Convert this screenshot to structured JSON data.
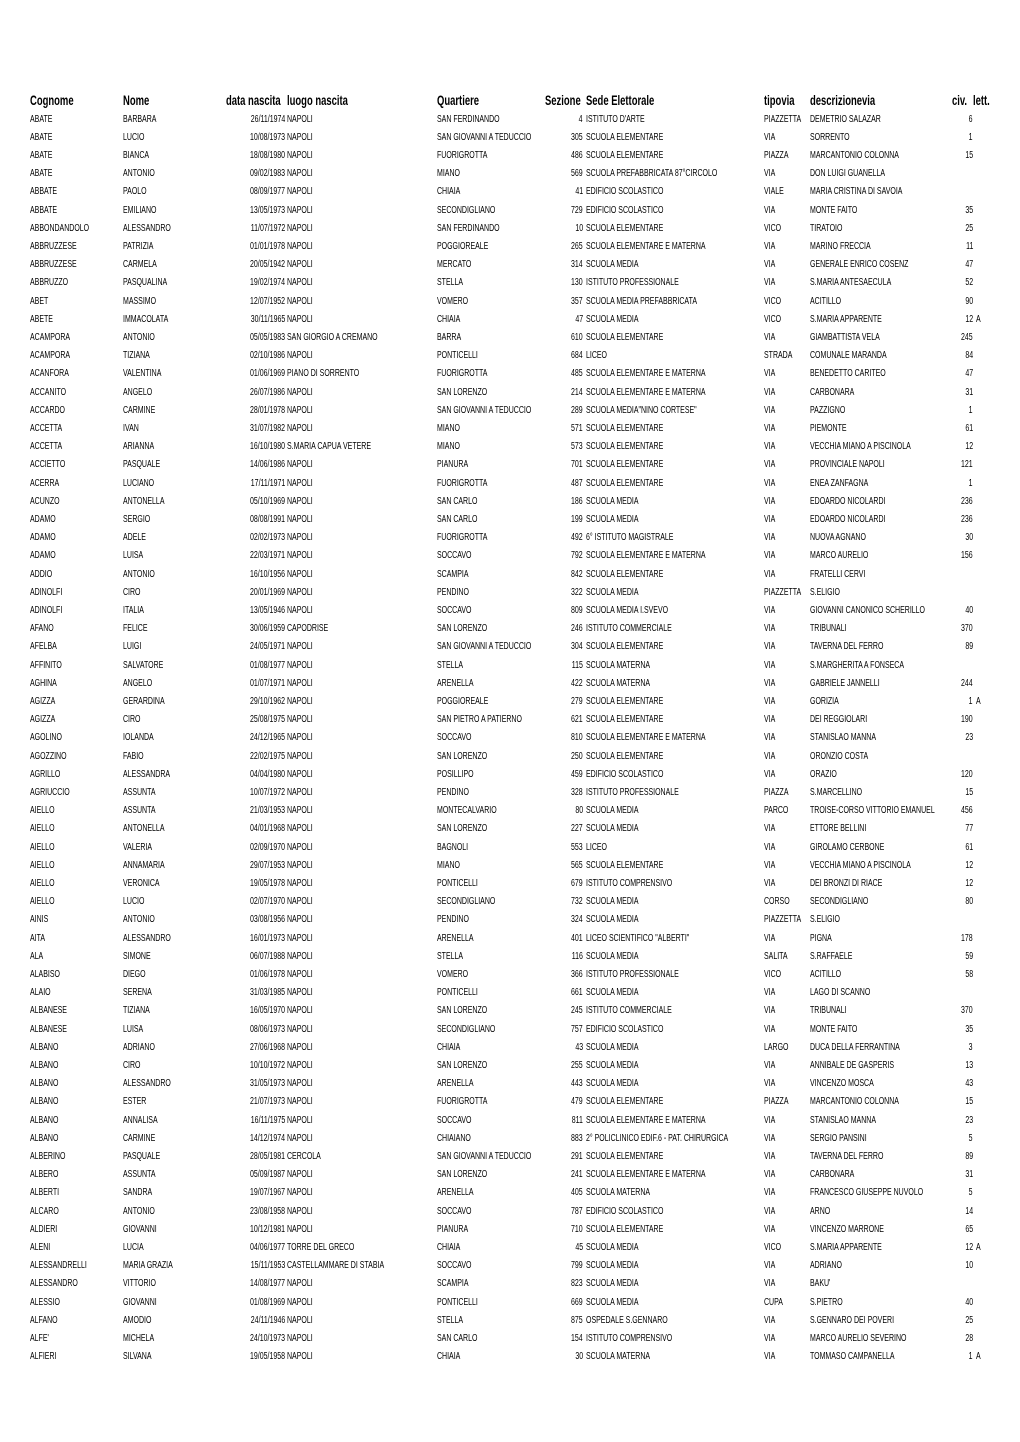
{
  "headers": [
    "Cognome",
    "Nome",
    "data nascita",
    "luogo nascita",
    "Quartiere",
    "Sezione",
    "Sede Elettorale",
    "tipovia",
    "descrizionevia",
    "civ.",
    "lett."
  ],
  "rows": [
    [
      "ABATE",
      "BARBARA",
      "26/11/1974",
      "NAPOLI",
      "SAN FERDINANDO",
      "4",
      "ISTITUTO D'ARTE",
      "PIAZZETTA",
      "DEMETRIO SALAZAR",
      "6",
      ""
    ],
    [
      "ABATE",
      "LUCIO",
      "10/08/1973",
      "NAPOLI",
      "SAN GIOVANNI A TEDUCCIO",
      "305",
      "SCUOLA ELEMENTARE",
      "VIA",
      "SORRENTO",
      "1",
      ""
    ],
    [
      "ABATE",
      "BIANCA",
      "18/08/1980",
      "NAPOLI",
      "FUORIGROTTA",
      "486",
      "SCUOLA ELEMENTARE",
      "PIAZZA",
      "MARCANTONIO COLONNA",
      "15",
      ""
    ],
    [
      "ABATE",
      "ANTONIO",
      "09/02/1983",
      "NAPOLI",
      "MIANO",
      "569",
      "SCUOLA PREFABBRICATA 87°CIRCOLO",
      "VIA",
      "DON LUIGI GUANELLA",
      "",
      ""
    ],
    [
      "ABBATE",
      "PAOLO",
      "08/09/1977",
      "NAPOLI",
      "CHIAIA",
      "41",
      "EDIFICIO SCOLASTICO",
      "VIALE",
      "MARIA CRISTINA DI SAVOIA",
      "",
      ""
    ],
    [
      "ABBATE",
      "EMILIANO",
      "13/05/1973",
      "NAPOLI",
      "SECONDIGLIANO",
      "729",
      "EDIFICIO SCOLASTICO",
      "VIA",
      "MONTE FAITO",
      "35",
      ""
    ],
    [
      "ABBONDANDOLO",
      "ALESSANDRO",
      "11/07/1972",
      "NAPOLI",
      "SAN FERDINANDO",
      "10",
      "SCUOLA ELEMENTARE",
      "VICO",
      "TIRATOIO",
      "25",
      ""
    ],
    [
      "ABBRUZZESE",
      "PATRIZIA",
      "01/01/1978",
      "NAPOLI",
      "POGGIOREALE",
      "265",
      "SCUOLA ELEMENTARE E MATERNA",
      "VIA",
      "MARINO FRECCIA",
      "11",
      ""
    ],
    [
      "ABBRUZZESE",
      "CARMELA",
      "20/05/1942",
      "NAPOLI",
      "MERCATO",
      "314",
      " SCUOLA MEDIA",
      "VIA",
      "GENERALE ENRICO COSENZ",
      "47",
      ""
    ],
    [
      "ABBRUZZO",
      "PASQUALINA",
      "19/02/1974",
      "NAPOLI",
      "STELLA",
      "130",
      "ISTITUTO PROFESSIONALE",
      "VIA",
      "S.MARIA ANTESAECULA",
      "52",
      ""
    ],
    [
      "ABET",
      "MASSIMO",
      "12/07/1952",
      "NAPOLI",
      "VOMERO",
      "357",
      "SCUOLA MEDIA PREFABBRICATA",
      "VICO",
      "ACITILLO",
      "90",
      ""
    ],
    [
      "ABETE",
      "IMMACOLATA",
      "30/11/1965",
      "NAPOLI",
      "CHIAIA",
      "47",
      "SCUOLA MEDIA",
      "VICO",
      "S.MARIA APPARENTE",
      "12",
      "A"
    ],
    [
      "ACAMPORA",
      "ANTONIO",
      "05/05/1983",
      "SAN GIORGIO A CREMANO",
      "BARRA",
      "610",
      "SCUOLA ELEMENTARE",
      "VIA",
      "GIAMBATTISTA VELA",
      "245",
      ""
    ],
    [
      "ACAMPORA",
      "TIZIANA",
      "02/10/1986",
      "NAPOLI",
      "PONTICELLI",
      "684",
      "LICEO",
      "STRADA",
      "COMUNALE MARANDA",
      "84",
      ""
    ],
    [
      "ACANFORA",
      "VALENTINA",
      "01/06/1969",
      "PIANO DI SORRENTO",
      "FUORIGROTTA",
      "485",
      "SCUOLA ELEMENTARE E MATERNA",
      "VIA",
      "BENEDETTO CARITEO",
      "47",
      ""
    ],
    [
      "ACCANITO",
      "ANGELO",
      "26/07/1986",
      "NAPOLI",
      "SAN LORENZO",
      "214",
      "SCUOLA ELEMENTARE E MATERNA",
      "VIA",
      "CARBONARA",
      "31",
      ""
    ],
    [
      "ACCARDO",
      "CARMINE",
      "28/01/1978",
      "NAPOLI",
      "SAN GIOVANNI A TEDUCCIO",
      "289",
      "SCUOLA MEDIA\"NINO CORTESE\"",
      "VIA",
      "PAZZIGNO",
      "1",
      ""
    ],
    [
      "ACCETTA",
      "IVAN",
      "31/07/1982",
      "NAPOLI",
      "MIANO",
      "571",
      "SCUOLA ELEMENTARE",
      "VIA",
      "PIEMONTE",
      "61",
      ""
    ],
    [
      "ACCETTA",
      "ARIANNA",
      "16/10/1980",
      "S.MARIA CAPUA VETERE",
      "MIANO",
      "573",
      "SCUOLA ELEMENTARE",
      "VIA",
      "VECCHIA MIANO A PISCINOLA",
      "12",
      ""
    ],
    [
      "ACCIETTO",
      "PASQUALE",
      "14/06/1986",
      "NAPOLI",
      "PIANURA",
      "701",
      "SCUOLA ELEMENTARE",
      "VIA",
      "PROVINCIALE NAPOLI",
      "121",
      ""
    ],
    [
      "ACERRA",
      "LUCIANO",
      "17/11/1971",
      "NAPOLI",
      "FUORIGROTTA",
      "487",
      "SCUOLA ELEMENTARE",
      "VIA",
      "ENEA ZANFAGNA",
      "1",
      ""
    ],
    [
      "ACUNZO",
      "ANTONELLA",
      "05/10/1969",
      "NAPOLI",
      "SAN CARLO",
      "186",
      "SCUOLA MEDIA",
      "VIA",
      "EDOARDO NICOLARDI",
      "236",
      ""
    ],
    [
      "ADAMO",
      "SERGIO",
      "08/08/1991",
      "NAPOLI",
      "SAN CARLO",
      "199",
      "SCUOLA MEDIA",
      "VIA",
      "EDOARDO NICOLARDI",
      "236",
      ""
    ],
    [
      "ADAMO",
      "ADELE",
      "02/02/1973",
      "NAPOLI",
      "FUORIGROTTA",
      "492",
      "6° ISTITUTO MAGISTRALE",
      "VIA",
      "NUOVA AGNANO",
      "30",
      ""
    ],
    [
      "ADAMO",
      "LUISA",
      "22/03/1971",
      "NAPOLI",
      "SOCCAVO",
      "792",
      "SCUOLA ELEMENTARE E MATERNA",
      "VIA",
      "MARCO AURELIO",
      "156",
      ""
    ],
    [
      "ADDIO",
      "ANTONIO",
      "16/10/1956",
      "NAPOLI",
      "SCAMPIA",
      "842",
      "SCUOLA ELEMENTARE",
      "VIA",
      "FRATELLI CERVI",
      "",
      ""
    ],
    [
      "ADINOLFI",
      "CIRO",
      "20/01/1969",
      "NAPOLI",
      "PENDINO",
      "322",
      "SCUOLA MEDIA",
      "PIAZZETTA",
      "S.ELIGIO",
      "",
      ""
    ],
    [
      "ADINOLFI",
      "ITALIA",
      "13/05/1946",
      "NAPOLI",
      "SOCCAVO",
      "809",
      "SCUOLA MEDIA I.SVEVO",
      "VIA",
      "GIOVANNI CANONICO SCHERILLO",
      "40",
      ""
    ],
    [
      "AFANO",
      "FELICE",
      "30/06/1959",
      "CAPODRISE",
      "SAN LORENZO",
      "246",
      "ISTITUTO COMMERCIALE",
      "VIA",
      "TRIBUNALI",
      "370",
      ""
    ],
    [
      "AFELBA",
      "LUIGI",
      "24/05/1971",
      "NAPOLI",
      "SAN GIOVANNI A TEDUCCIO",
      "304",
      "SCUOLA ELEMENTARE",
      "VIA",
      "TAVERNA DEL FERRO",
      "89",
      ""
    ],
    [
      "AFFINITO",
      "SALVATORE",
      "01/08/1977",
      "NAPOLI",
      "STELLA",
      "115",
      "SCUOLA MATERNA",
      "VIA",
      "S.MARGHERITA A FONSECA",
      "",
      ""
    ],
    [
      "AGHINA",
      "ANGELO",
      "01/07/1971",
      "NAPOLI",
      "ARENELLA",
      "422",
      "SCUOLA MATERNA",
      "VIA",
      "GABRIELE JANNELLI",
      "244",
      ""
    ],
    [
      "AGIZZA",
      "GERARDINA",
      "29/10/1962",
      "NAPOLI",
      "POGGIOREALE",
      "279",
      "SCUOLA ELEMENTARE",
      "VIA",
      "GORIZIA",
      "1",
      "A"
    ],
    [
      "AGIZZA",
      "CIRO",
      "25/08/1975",
      "NAPOLI",
      "SAN PIETRO A PATIERNO",
      "621",
      "SCUOLA ELEMENTARE",
      "VIA",
      "DEI REGGIOLARI",
      "190",
      ""
    ],
    [
      "AGOLINO",
      "IOLANDA",
      "24/12/1965",
      "NAPOLI",
      "SOCCAVO",
      "810",
      "SCUOLA ELEMENTARE E MATERNA",
      "VIA",
      "STANISLAO MANNA",
      "23",
      ""
    ],
    [
      "AGOZZINO",
      "FABIO",
      "22/02/1975",
      "NAPOLI",
      "SAN LORENZO",
      "250",
      "SCUOLA ELEMENTARE",
      "VIA",
      "ORONZIO COSTA",
      "",
      ""
    ],
    [
      "AGRILLO",
      "ALESSANDRA",
      "04/04/1980",
      "NAPOLI",
      "POSILLIPO",
      "459",
      "EDIFICIO SCOLASTICO",
      "VIA",
      "ORAZIO",
      "120",
      ""
    ],
    [
      "AGRIUCCIO",
      "ASSUNTA",
      "10/07/1972",
      "NAPOLI",
      "PENDINO",
      "328",
      "ISTITUTO PROFESSIONALE",
      "PIAZZA",
      "S.MARCELLINO",
      "15",
      ""
    ],
    [
      "AIELLO",
      "ASSUNTA",
      "21/03/1953",
      "NAPOLI",
      "MONTECALVARIO",
      "80",
      "SCUOLA MEDIA",
      "PARCO",
      "TROISE-CORSO VITTORIO EMANUEL",
      "456",
      ""
    ],
    [
      "AIELLO",
      "ANTONELLA",
      "04/01/1968",
      "NAPOLI",
      "SAN LORENZO",
      "227",
      "SCUOLA MEDIA",
      "VIA",
      "ETTORE BELLINI",
      "77",
      ""
    ],
    [
      "AIELLO",
      "VALERIA",
      "02/09/1970",
      "NAPOLI",
      "BAGNOLI",
      "553",
      "LICEO",
      "VIA",
      "GIROLAMO CERBONE",
      "61",
      ""
    ],
    [
      "AIELLO",
      "ANNAMARIA",
      "29/07/1953",
      "NAPOLI",
      "MIANO",
      "565",
      "SCUOLA ELEMENTARE",
      "VIA",
      "VECCHIA MIANO A PISCINOLA",
      "12",
      ""
    ],
    [
      "AIELLO",
      "VERONICA",
      "19/05/1978",
      "NAPOLI",
      "PONTICELLI",
      "679",
      "ISTITUTO COMPRENSIVO",
      "VIA",
      "DEI BRONZI DI RIACE",
      "12",
      ""
    ],
    [
      "AIELLO",
      "LUCIO",
      "02/07/1970",
      "NAPOLI",
      "SECONDIGLIANO",
      "732",
      "SCUOLA MEDIA",
      "CORSO",
      "SECONDIGLIANO",
      "80",
      ""
    ],
    [
      "AINIS",
      "ANTONIO",
      "03/08/1956",
      "NAPOLI",
      "PENDINO",
      "324",
      "SCUOLA MEDIA",
      "PIAZZETTA",
      "S.ELIGIO",
      "",
      ""
    ],
    [
      "AITA",
      "ALESSANDRO",
      "16/01/1973",
      "NAPOLI",
      "ARENELLA",
      "401",
      "LICEO SCIENTIFICO \"ALBERTI\"",
      "VIA",
      "PIGNA",
      "178",
      ""
    ],
    [
      "ALA",
      "SIMONE",
      "06/07/1988",
      "NAPOLI",
      "STELLA",
      "116",
      "SCUOLA MEDIA",
      "SALITA",
      "S.RAFFAELE",
      "59",
      ""
    ],
    [
      "ALABISO",
      "DIEGO",
      "01/06/1978",
      "NAPOLI",
      "VOMERO",
      "366",
      "ISTITUTO PROFESSIONALE",
      "VICO",
      "ACITILLO",
      "58",
      ""
    ],
    [
      "ALAIO",
      "SERENA",
      "31/03/1985",
      "NAPOLI",
      "PONTICELLI",
      "661",
      "SCUOLA MEDIA",
      "VIA",
      "LAGO DI SCANNO",
      "",
      ""
    ],
    [
      "ALBANESE",
      "TIZIANA",
      "16/05/1970",
      "NAPOLI",
      "SAN LORENZO",
      "245",
      "ISTITUTO COMMERCIALE",
      "VIA",
      "TRIBUNALI",
      "370",
      ""
    ],
    [
      "ALBANESE",
      "LUISA",
      "08/06/1973",
      "NAPOLI",
      "SECONDIGLIANO",
      "757",
      "EDIFICIO SCOLASTICO",
      "VIA",
      "MONTE FAITO",
      "35",
      ""
    ],
    [
      "ALBANO",
      "ADRIANO",
      "27/06/1968",
      "NAPOLI",
      "CHIAIA",
      "43",
      "SCUOLA MEDIA",
      "LARGO",
      "DUCA DELLA FERRANTINA",
      "3",
      ""
    ],
    [
      "ALBANO",
      "CIRO",
      "10/10/1972",
      "NAPOLI",
      "SAN LORENZO",
      "255",
      "SCUOLA MEDIA",
      "VIA",
      "ANNIBALE DE GASPERIS",
      "13",
      ""
    ],
    [
      "ALBANO",
      "ALESSANDRO",
      "31/05/1973",
      "NAPOLI",
      "ARENELLA",
      "443",
      "SCUOLA MEDIA",
      "VIA",
      "VINCENZO MOSCA",
      "43",
      ""
    ],
    [
      "ALBANO",
      "ESTER",
      "21/07/1973",
      "NAPOLI",
      "FUORIGROTTA",
      "479",
      "SCUOLA ELEMENTARE",
      "PIAZZA",
      "MARCANTONIO COLONNA",
      "15",
      ""
    ],
    [
      "ALBANO",
      "ANNALISA",
      "16/11/1975",
      "NAPOLI",
      "SOCCAVO",
      "811",
      "SCUOLA ELEMENTARE E MATERNA",
      "VIA",
      "STANISLAO MANNA",
      "23",
      ""
    ],
    [
      "ALBANO",
      "CARMINE",
      "14/12/1974",
      "NAPOLI",
      "CHIAIANO",
      "883",
      "2° POLICLINICO EDIF.6 - PAT. CHIRURGICA",
      "VIA",
      "SERGIO PANSINI",
      "5",
      ""
    ],
    [
      "ALBERINO",
      "PASQUALE",
      "28/05/1981",
      "CERCOLA",
      "SAN GIOVANNI A TEDUCCIO",
      "291",
      "SCUOLA ELEMENTARE",
      "VIA",
      "TAVERNA DEL FERRO",
      "89",
      ""
    ],
    [
      "ALBERO",
      "ASSUNTA",
      "05/09/1987",
      "NAPOLI",
      "SAN LORENZO",
      "241",
      "SCUOLA ELEMENTARE E MATERNA",
      "VIA",
      "CARBONARA",
      "31",
      ""
    ],
    [
      "ALBERTI",
      "SANDRA",
      "19/07/1967",
      "NAPOLI",
      "ARENELLA",
      "405",
      "SCUOLA MATERNA",
      "VIA",
      "FRANCESCO GIUSEPPE NUVOLO",
      "5",
      ""
    ],
    [
      "ALCARO",
      "ANTONIO",
      "23/08/1958",
      "NAPOLI",
      "SOCCAVO",
      "787",
      "EDIFICIO SCOLASTICO",
      "VIA",
      "ARNO",
      "14",
      ""
    ],
    [
      "ALDIERI",
      "GIOVANNI",
      "10/12/1981",
      "NAPOLI",
      "PIANURA",
      "710",
      "SCUOLA ELEMENTARE",
      "VIA",
      "VINCENZO MARRONE",
      "65",
      ""
    ],
    [
      "ALENI",
      "LUCIA",
      "04/06/1977",
      "TORRE DEL GRECO",
      "CHIAIA",
      "45",
      "SCUOLA MEDIA",
      "VICO",
      "S.MARIA APPARENTE",
      "12",
      "A"
    ],
    [
      "ALESSANDRELLI",
      "MARIA GRAZIA",
      "15/11/1953",
      "CASTELLAMMARE DI STABIA",
      "SOCCAVO",
      "799",
      "SCUOLA MEDIA",
      "VIA",
      "ADRIANO",
      "10",
      ""
    ],
    [
      "ALESSANDRO",
      "VITTORIO",
      "14/08/1977",
      "NAPOLI",
      "SCAMPIA",
      "823",
      "SCUOLA MEDIA",
      "VIA",
      "BAKU'",
      "",
      ""
    ],
    [
      "ALESSIO",
      "GIOVANNI",
      "01/08/1969",
      "NAPOLI",
      "PONTICELLI",
      "669",
      "SCUOLA MEDIA",
      "CUPA",
      "S.PIETRO",
      "40",
      ""
    ],
    [
      "ALFANO",
      "AMODIO",
      "24/11/1946",
      "NAPOLI",
      "STELLA",
      "875",
      "OSPEDALE S.GENNARO",
      "VIA",
      "S.GENNARO DEI POVERI",
      "25",
      ""
    ],
    [
      "ALFE'",
      "MICHELA",
      "24/10/1973",
      "NAPOLI",
      "SAN CARLO",
      "154",
      "ISTITUTO COMPRENSIVO",
      "VIA",
      "MARCO AURELIO SEVERINO",
      "28",
      ""
    ],
    [
      "ALFIERI",
      "SILVANA",
      "19/05/1958",
      "NAPOLI",
      "CHIAIA",
      "30",
      "SCUOLA MATERNA",
      "VIA",
      "TOMMASO CAMPANELLA",
      "1",
      "A"
    ]
  ]
}
